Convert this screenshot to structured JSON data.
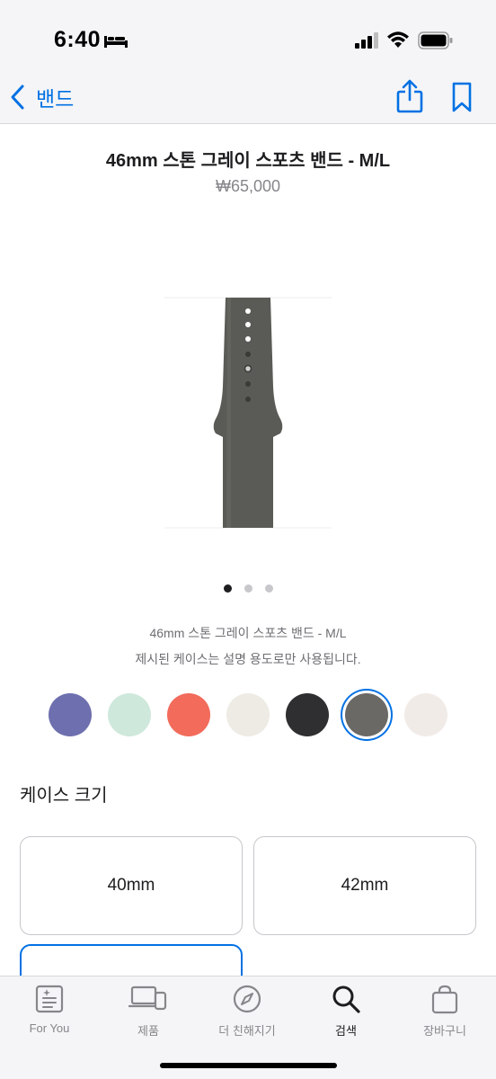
{
  "status_bar": {
    "time": "6:40",
    "icons": [
      "sleep-icon",
      "cellular-signal-icon",
      "wifi-icon",
      "battery-icon"
    ]
  },
  "nav": {
    "back_label": "밴드",
    "icons": [
      "chevron-left-icon",
      "share-icon",
      "bookmark-icon"
    ],
    "accent_color": "#0071e3"
  },
  "product": {
    "title": "46mm 스톤 그레이 스포츠 밴드 - M/L",
    "price": "₩65,000",
    "caption_name": "46mm 스톤 그레이 스포츠 밴드 - M/L",
    "caption_note": "제시된 케이스는 설명 용도로만 사용됩니다.",
    "band_color": "#5a5a56"
  },
  "gallery": {
    "pages": 3,
    "current_page": 1
  },
  "swatches": [
    {
      "name": "purple",
      "color": "#6e6fae",
      "selected": false
    },
    {
      "name": "mint",
      "color": "#cfe8dc",
      "selected": false
    },
    {
      "name": "coral",
      "color": "#f26b5b",
      "selected": false
    },
    {
      "name": "light-beige",
      "color": "#eeebe5",
      "selected": false
    },
    {
      "name": "black",
      "color": "#2f2f31",
      "selected": false
    },
    {
      "name": "stone-gray",
      "color": "#6a6965",
      "selected": true
    },
    {
      "name": "light-pink",
      "color": "#f1ebe8",
      "selected": false
    }
  ],
  "case_size": {
    "title": "케이스 크기",
    "options": [
      {
        "label": "40mm",
        "selected": false
      },
      {
        "label": "42mm",
        "selected": false
      },
      {
        "label": "",
        "selected": true
      }
    ]
  },
  "tab_bar": {
    "tabs": [
      {
        "label": "For You",
        "icon": "for-you-icon",
        "active": false
      },
      {
        "label": "제품",
        "icon": "products-icon",
        "active": false
      },
      {
        "label": "더 친해지기",
        "icon": "compass-icon",
        "active": false
      },
      {
        "label": "검색",
        "icon": "search-icon",
        "active": true
      },
      {
        "label": "장바구니",
        "icon": "bag-icon",
        "active": false
      }
    ]
  }
}
